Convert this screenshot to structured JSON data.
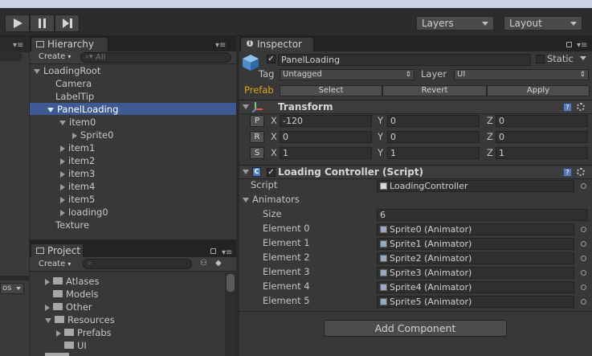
{
  "toolbar": {
    "layers_label": "Layers",
    "layout_label": "Layout"
  },
  "hierarchy": {
    "tab_label": "Hierarchy",
    "create_label": "Create",
    "search_placeholder": "All",
    "items": [
      {
        "label": "LoadingRoot"
      },
      {
        "label": "Camera"
      },
      {
        "label": "LabelTip"
      },
      {
        "label": "PanelLoading"
      },
      {
        "label": "item0"
      },
      {
        "label": "Sprite0"
      },
      {
        "label": "item1"
      },
      {
        "label": "item2"
      },
      {
        "label": "item3"
      },
      {
        "label": "item4"
      },
      {
        "label": "item5"
      },
      {
        "label": "loading0"
      },
      {
        "label": "Texture"
      }
    ]
  },
  "project": {
    "tab_label": "Project",
    "create_label": "Create",
    "folders": [
      {
        "label": "Atlases"
      },
      {
        "label": "Models"
      },
      {
        "label": "Other"
      },
      {
        "label": "Resources"
      },
      {
        "label": "Prefabs"
      },
      {
        "label": "UI"
      }
    ]
  },
  "left_panel": {
    "dropdown_label": "os"
  },
  "inspector": {
    "tab_label": "Inspector",
    "object_name": "PanelLoading",
    "static_label": "Static",
    "tag_label": "Tag",
    "tag_value": "Untagged",
    "layer_label": "Layer",
    "layer_value": "UI",
    "prefab_label": "Prefab",
    "prefab_select": "Select",
    "prefab_revert": "Revert",
    "prefab_apply": "Apply",
    "transform": {
      "title": "Transform",
      "rows": [
        {
          "btn": "P",
          "x_label": "X",
          "x": "-120",
          "y_label": "Y",
          "y": "0",
          "z_label": "Z",
          "z": "0"
        },
        {
          "btn": "R",
          "x_label": "X",
          "x": "0",
          "y_label": "Y",
          "y": "0",
          "z_label": "Z",
          "z": "0"
        },
        {
          "btn": "S",
          "x_label": "X",
          "x": "1",
          "y_label": "Y",
          "y": "1",
          "z_label": "Z",
          "z": "1"
        }
      ]
    },
    "loading_controller": {
      "title": "Loading Controller (Script)",
      "script_label": "Script",
      "script_value": "LoadingController",
      "animators_label": "Animators",
      "size_label": "Size",
      "size_value": "6",
      "elements": [
        {
          "label": "Element 0",
          "value": "Sprite0 (Animator)"
        },
        {
          "label": "Element 1",
          "value": "Sprite1 (Animator)"
        },
        {
          "label": "Element 2",
          "value": "Sprite2 (Animator)"
        },
        {
          "label": "Element 3",
          "value": "Sprite3 (Animator)"
        },
        {
          "label": "Element 4",
          "value": "Sprite4 (Animator)"
        },
        {
          "label": "Element 5",
          "value": "Sprite5 (Animator)"
        }
      ]
    },
    "add_component_label": "Add Component"
  },
  "colors": {
    "selection": "#3d5a92",
    "prefab_text": "#e0a81a",
    "panel_bg": "#383838"
  }
}
